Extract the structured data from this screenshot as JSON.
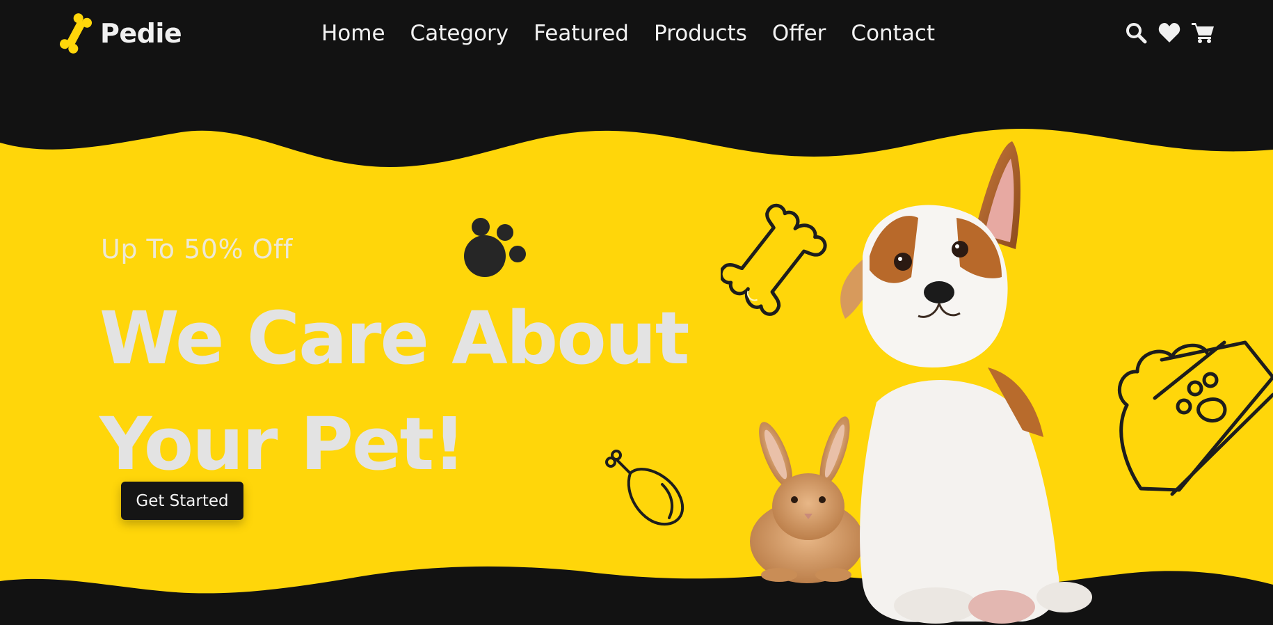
{
  "brand": {
    "name": "Pedie"
  },
  "nav": {
    "items": [
      {
        "label": "Home"
      },
      {
        "label": "Category"
      },
      {
        "label": "Featured"
      },
      {
        "label": "Products"
      },
      {
        "label": "Offer"
      },
      {
        "label": "Contact"
      }
    ],
    "actions": [
      "search-icon",
      "heart-icon",
      "cart-icon"
    ]
  },
  "hero": {
    "offer": "Up To 50% Off",
    "headline_line1": "We Care About",
    "headline_line2": "Your Pet!",
    "cta_label": "Get Started"
  },
  "colors": {
    "background": "#121212",
    "accent_yellow": "#FFD60A",
    "text_light": "#E3E3E3",
    "button_dark": "#151515"
  }
}
